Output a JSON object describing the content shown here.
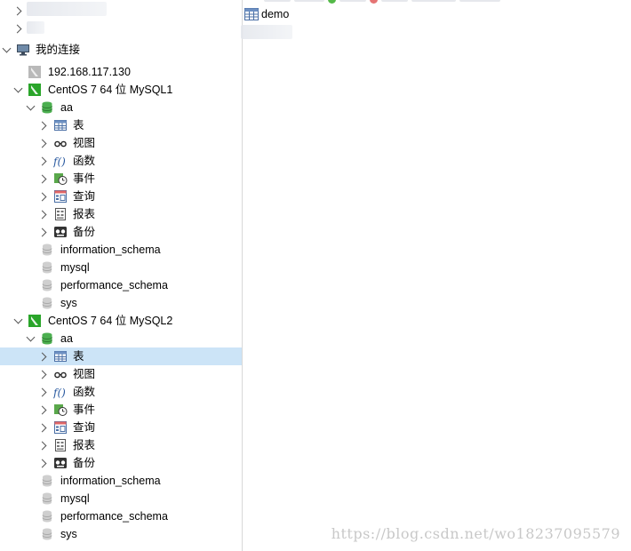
{
  "sidebar": {
    "group_label": "我的连接",
    "connection_ip": "192.168.117.130",
    "connections": [
      {
        "name": "CentOS 7 64 位 MySQL1",
        "database": "aa",
        "objects": [
          "表",
          "视图",
          "函数",
          "事件",
          "查询",
          "报表",
          "备份"
        ],
        "other_dbs": [
          "information_schema",
          "mysql",
          "performance_schema",
          "sys"
        ]
      },
      {
        "name": "CentOS 7 64 位 MySQL2",
        "database": "aa",
        "objects": [
          "表",
          "视图",
          "函数",
          "事件",
          "查询",
          "报表",
          "备份"
        ],
        "other_dbs": [
          "information_schema",
          "mysql",
          "performance_schema",
          "sys"
        ]
      }
    ],
    "selected": "表"
  },
  "main": {
    "tables": [
      {
        "name": "demo",
        "icon": "table-icon"
      }
    ]
  },
  "watermark": "https://blog.csdn.net/wo18237095579",
  "colors": {
    "selection": "#cce4f7",
    "db_green": "#4caf50",
    "connection_green": "#2aa52a"
  }
}
